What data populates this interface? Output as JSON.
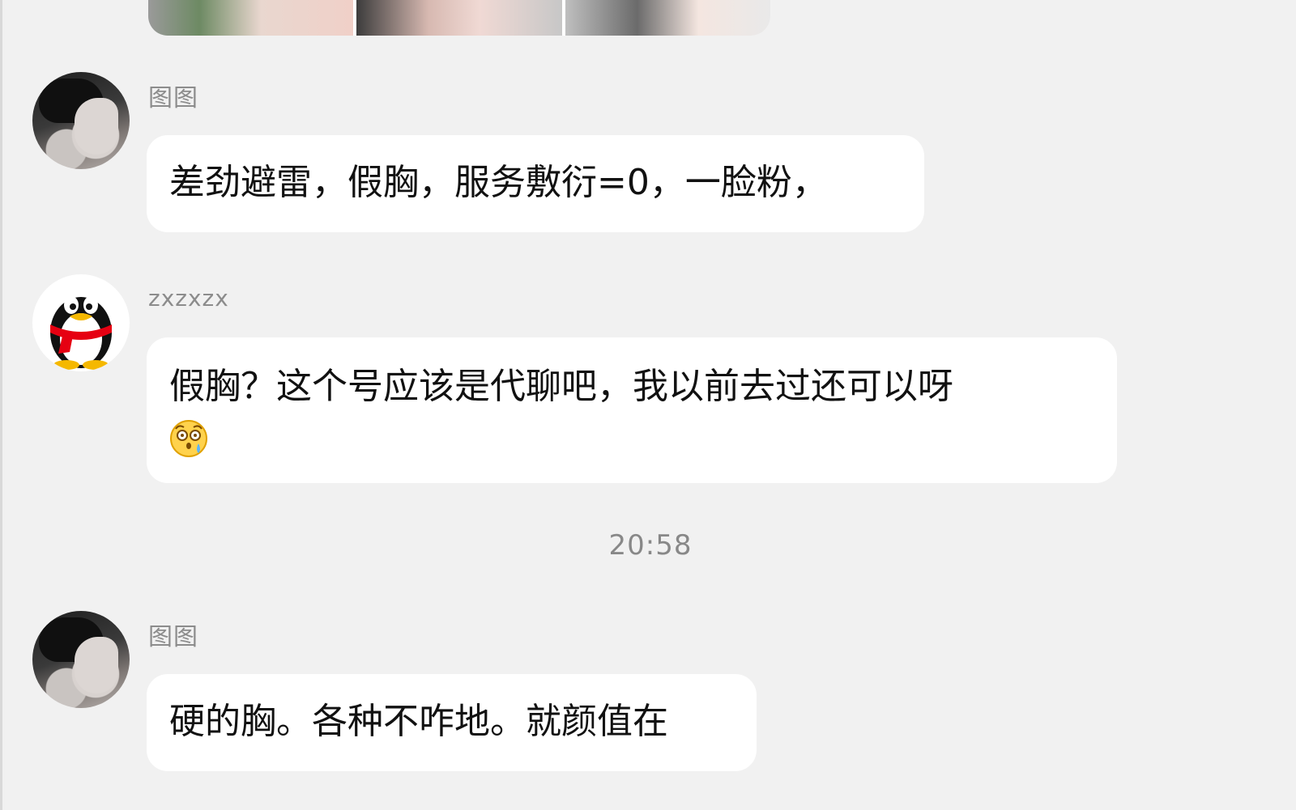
{
  "chat": {
    "messages": [
      {
        "sender": "图图",
        "text": "差劲避雷，假胸，服务敷衍=0，一脸粉，",
        "avatar": "anime-boy-avatar"
      },
      {
        "sender": "zxzxzx",
        "text": "假胸？这个号应该是代聊吧，我以前去过还可以呀",
        "emoji": "shocked-sweat-emoji",
        "avatar": "qq-penguin-avatar"
      },
      {
        "sender": "图图",
        "text": "硬的胸。各种不咋地。就颜值在",
        "avatar": "anime-boy-avatar"
      }
    ],
    "timestamp": "20:58"
  },
  "colors": {
    "background": "#f1f1f1",
    "bubble": "#ffffff",
    "sender_text": "#8c8c8c",
    "message_text": "#111111",
    "timestamp_text": "#888888",
    "qq_red_scarf": "#e60012",
    "qq_yellow": "#f5b800"
  }
}
